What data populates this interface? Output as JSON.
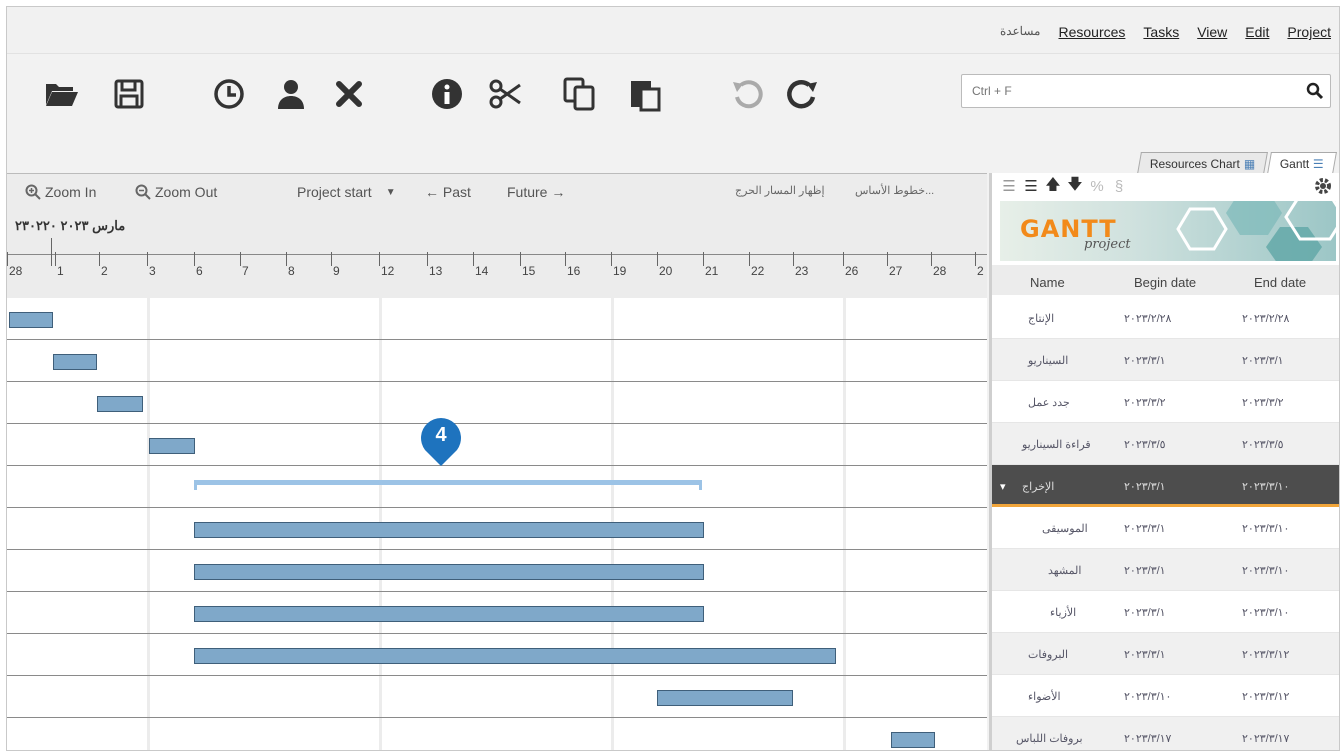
{
  "menu": {
    "items": [
      "مساعدة",
      "Resources",
      "Tasks",
      "View",
      "Edit",
      "Project"
    ]
  },
  "toolbar": {
    "icons": [
      "folder-open-icon",
      "save-icon",
      "history-icon",
      "user-icon",
      "delete-icon",
      "info-icon",
      "cut-icon",
      "copy-icon",
      "paste-icon",
      "undo-icon",
      "redo-icon"
    ]
  },
  "search": {
    "placeholder": "Ctrl + F"
  },
  "tabs": {
    "resources_label": "Resources Chart",
    "gantt_label": "Gantt"
  },
  "chart_controls": {
    "zoom_in": "Zoom In",
    "zoom_out": "Zoom Out",
    "project_start": "Project start",
    "past": "← Past",
    "future": "Future →",
    "baselines": "خطوط الأساس...",
    "critical_path": "إظهار المسار الحرج"
  },
  "timeline": {
    "month_label": "مارس ٢٠٢٣ ٢٣٠٢٢٠",
    "days": [
      "28",
      "1",
      "2",
      "3",
      "6",
      "7",
      "8",
      "9",
      "12",
      "13",
      "14",
      "15",
      "16",
      "19",
      "20",
      "21",
      "22",
      "23",
      "26",
      "27",
      "28",
      "2"
    ]
  },
  "marker": {
    "number": "4"
  },
  "panel": {
    "logo_title": "GANTT",
    "logo_subtitle": "project",
    "columns": {
      "name": "Name",
      "begin": "Begin date",
      "end": "End date"
    },
    "rows": [
      {
        "name": "الإنتاج",
        "begin": "٢٠٢٣/٢/٢٨",
        "end": "٢٠٢٣/٢/٢٨"
      },
      {
        "name": "السيناريو",
        "begin": "٢٠٢٣/٣/١",
        "end": "٢٠٢٣/٣/١"
      },
      {
        "name": "جدد عمل",
        "begin": "٢٠٢٣/٣/٢",
        "end": "٢٠٢٣/٣/٢"
      },
      {
        "name": "قراءة السيناريو",
        "begin": "٢٠٢٣/٣/٥",
        "end": "٢٠٢٣/٣/٥"
      },
      {
        "name": "الإخراج",
        "begin": "٢٠٢٣/٣/١",
        "end": "٢٠٢٣/٣/١٠"
      },
      {
        "name": "الموسيقى",
        "begin": "٢٠٢٣/٣/١",
        "end": "٢٠٢٣/٣/١٠"
      },
      {
        "name": "المشهد",
        "begin": "٢٠٢٣/٣/١",
        "end": "٢٠٢٣/٣/١٠"
      },
      {
        "name": "الأزياء",
        "begin": "٢٠٢٣/٣/١",
        "end": "٢٠٢٣/٣/١٠"
      },
      {
        "name": "البروفات",
        "begin": "٢٠٢٣/٣/١",
        "end": "٢٠٢٣/٣/١٢"
      },
      {
        "name": "الأضواء",
        "begin": "٢٠٢٣/٣/١٠",
        "end": "٢٠٢٣/٣/١٢"
      },
      {
        "name": "بروفات اللباس",
        "begin": "٢٠٢٣/٣/١٧",
        "end": "٢٠٢٣/٣/١٧"
      }
    ]
  },
  "colors": {
    "bar_fill": "#7fa8c9",
    "bar_border": "#3f5f7a",
    "summary": "#9cc3e6",
    "marker": "#1e73be",
    "group_row": "#4d4d4d",
    "group_underline": "#f1a53a"
  }
}
